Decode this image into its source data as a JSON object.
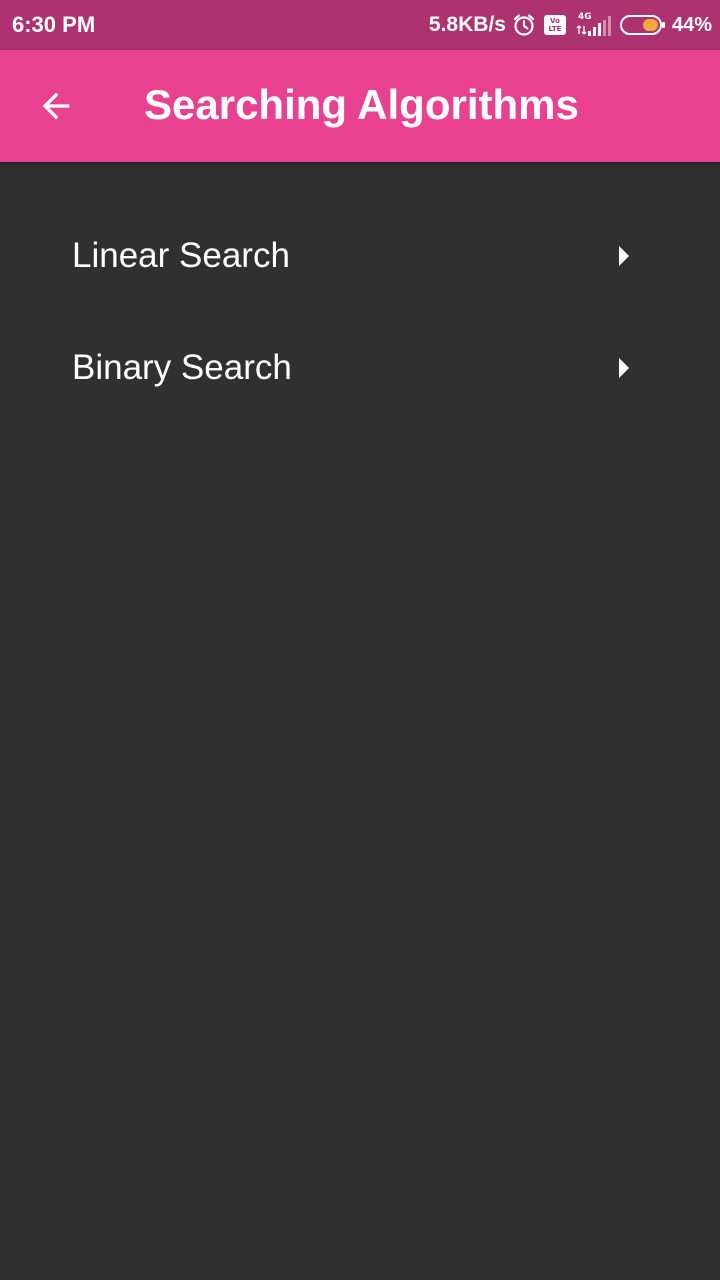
{
  "status_bar": {
    "time": "6:30 PM",
    "net_speed": "5.8KB/s",
    "volte_top": "Vo",
    "volte_bottom": "LTE",
    "network_type": "4G",
    "battery_percent": "44%",
    "battery_level": 0.44,
    "icons": [
      "alarm-icon",
      "volte-icon",
      "signal-icon",
      "battery-icon"
    ],
    "background": "#ad3270"
  },
  "app_bar": {
    "title": "Searching Algorithms",
    "back_icon": "arrow-back-icon",
    "background": "#e84190"
  },
  "list": {
    "items": [
      {
        "label": "Linear Search",
        "icon": "arrow-right-icon"
      },
      {
        "label": "Binary Search",
        "icon": "arrow-right-icon"
      }
    ]
  },
  "colors": {
    "page_background": "#303030",
    "text": "#ffffff",
    "battery_fill": "#f2a93b"
  }
}
